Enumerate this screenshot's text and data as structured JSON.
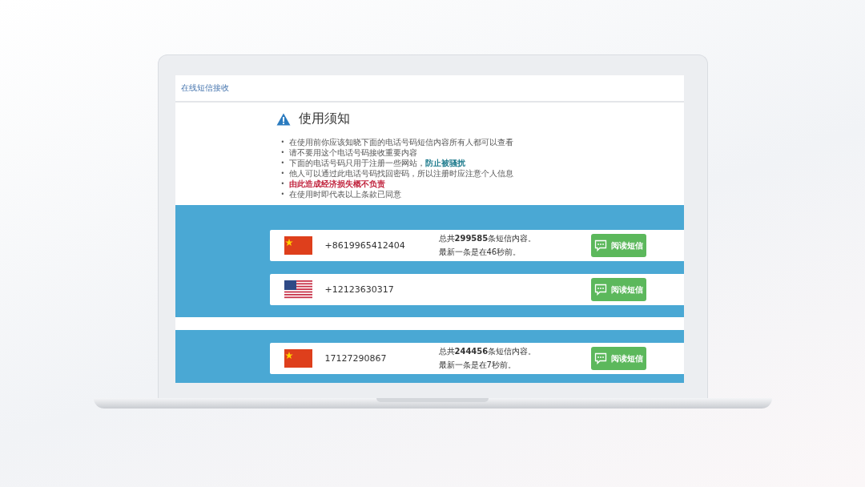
{
  "header": {
    "link": "在线短信接收"
  },
  "notice": {
    "title": "使用须知",
    "items": [
      {
        "kind": "plain",
        "bullet": "•",
        "text": "在使用前你应该知晓下面的电话号码短信内容所有人都可以查看"
      },
      {
        "kind": "plain",
        "bullet": "•",
        "text": "请不要用这个电话号码接收重要内容"
      },
      {
        "kind": "plain",
        "bullet": "•",
        "text": "下面的电话号码只用于注册一些网站，**防止被骚扰**"
      },
      {
        "kind": "plain",
        "bullet": "•",
        "text": "他人可以通过此电话号码找回密码，所以注册时应注意个人信息"
      },
      {
        "kind": "warning",
        "bullet": "•",
        "text": "**由此造成经济损失概不负责**"
      },
      {
        "kind": "plain",
        "bullet": "•",
        "text": "在使用时即代表以上条款已同意"
      }
    ]
  },
  "sections": [
    {
      "numbers": [
        {
          "kind": "china",
          "number": "+8619965412404",
          "info": [
            "总共**299585**条短信内容。",
            "最新一条是在46秒前。"
          ],
          "button": "阅读短信"
        },
        {
          "kind": "usa",
          "number": "+12123630317",
          "button": "阅读短信"
        }
      ]
    },
    {
      "numbers": [
        {
          "kind": "china",
          "number": "17127290867",
          "info": [
            "总共**244456**条短信内容。",
            "最新一条是在7秒前。"
          ],
          "button": "阅读短信"
        }
      ]
    }
  ]
}
